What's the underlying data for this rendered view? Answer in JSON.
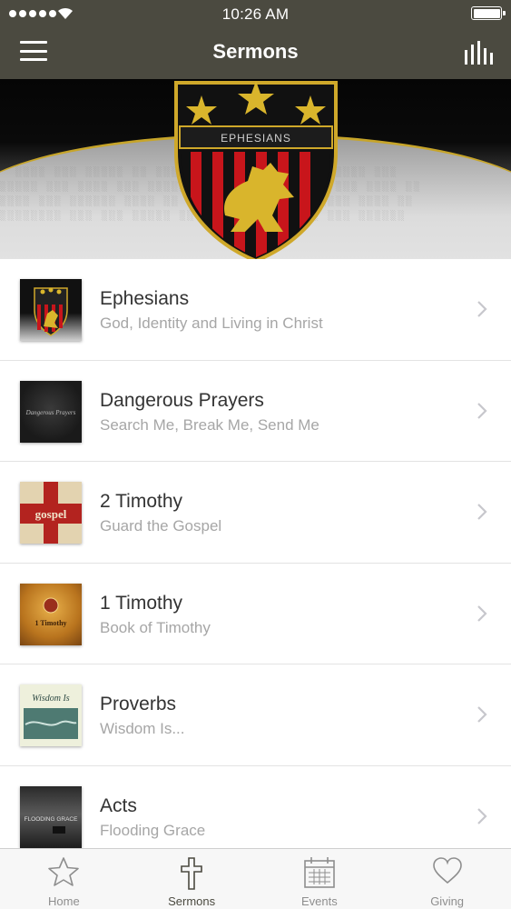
{
  "status_bar": {
    "time": "10:26 AM"
  },
  "header": {
    "title": "Sermons"
  },
  "hero": {
    "badge_text": "EPHESIANS"
  },
  "sermons": [
    {
      "title": "Ephesians",
      "subtitle": "God, Identity and Living in Christ",
      "thumb_text": ""
    },
    {
      "title": "Dangerous Prayers",
      "subtitle": "Search Me, Break Me, Send Me",
      "thumb_text": "Dangerous Prayers"
    },
    {
      "title": "2 Timothy",
      "subtitle": "Guard the Gospel",
      "thumb_text": "gospel"
    },
    {
      "title": "1 Timothy",
      "subtitle": "Book of Timothy",
      "thumb_text": "1 Timothy"
    },
    {
      "title": "Proverbs",
      "subtitle": "Wisdom Is...",
      "thumb_text": "Wisdom Is"
    },
    {
      "title": "Acts",
      "subtitle": "Flooding Grace",
      "thumb_text": "FLOODING GRACE"
    }
  ],
  "tabs": [
    {
      "label": "Home",
      "icon": "star-icon"
    },
    {
      "label": "Sermons",
      "icon": "cross-icon"
    },
    {
      "label": "Events",
      "icon": "calendar-icon"
    },
    {
      "label": "Giving",
      "icon": "heart-icon"
    }
  ],
  "colors": {
    "nav_bg": "#4b4a40",
    "gold": "#d9b52c",
    "red": "#c8151b",
    "tab_active": "#4b4a40",
    "tab_inactive": "#8e8e8e"
  }
}
